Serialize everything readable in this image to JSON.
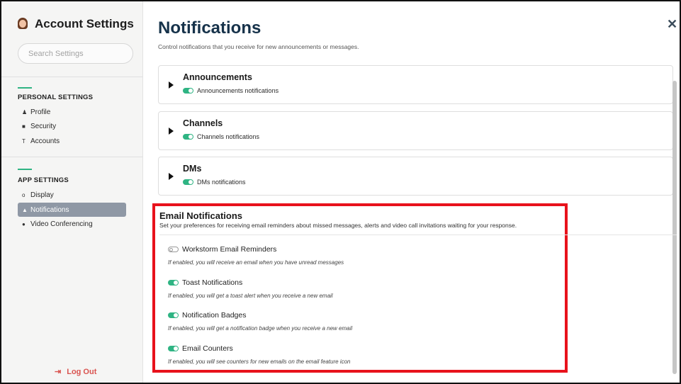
{
  "sidebar": {
    "title": "Account Settings",
    "search_placeholder": "Search Settings",
    "personal_heading": "PERSONAL SETTINGS",
    "personal_items": [
      {
        "label": "Profile",
        "icon": "person-icon"
      },
      {
        "label": "Security",
        "icon": "lock-icon"
      },
      {
        "label": "Accounts",
        "icon": "accounts-icon"
      }
    ],
    "app_heading": "APP SETTINGS",
    "app_items": [
      {
        "label": "Display",
        "icon": "display-icon"
      },
      {
        "label": "Notifications",
        "icon": "bell-icon",
        "active": true
      },
      {
        "label": "Video Conferencing",
        "icon": "video-icon"
      }
    ],
    "logout_label": "Log Out"
  },
  "main": {
    "title": "Notifications",
    "subtitle": "Control notifications that you receive for new announcements or messages.",
    "sections": [
      {
        "title": "Announcements",
        "toggle_label": "Announcements notifications",
        "enabled": true
      },
      {
        "title": "Channels",
        "toggle_label": "Channels notifications",
        "enabled": true
      },
      {
        "title": "DMs",
        "toggle_label": "DMs notifications",
        "enabled": true
      }
    ],
    "email": {
      "title": "Email Notifications",
      "description": "Set your preferences for receiving email reminders about missed messages, alerts and video call invitations waiting for your response.",
      "options": [
        {
          "label": "Workstorm Email Reminders",
          "hint": "If enabled, you will receive an email when you have unread messages",
          "enabled": false
        },
        {
          "label": "Toast Notifications",
          "hint": "If enabled, you will get a toast alert when you receive a new email",
          "enabled": true
        },
        {
          "label": "Notification Badges",
          "hint": "If enabled, you will get a notification badge when you receive a new email",
          "enabled": true
        },
        {
          "label": "Email Counters",
          "hint": "If enabled, you will see counters for new emails on the email feature icon",
          "enabled": true
        }
      ]
    }
  },
  "colors": {
    "accent_green": "#2fb483",
    "highlight_red": "#e8121c",
    "active_nav": "#8f98a5",
    "logout_red": "#d9534f"
  }
}
